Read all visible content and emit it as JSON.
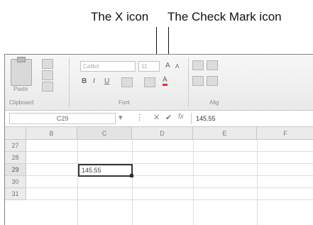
{
  "callouts": {
    "x_icon": "The X icon",
    "check_icon": "The Check Mark icon"
  },
  "ribbon": {
    "paste_label": "Paste",
    "clipboard_label": "Clipboard",
    "font_name": "Calibri",
    "font_size": "11",
    "font_group_label": "Font",
    "alignment_group_label": "Alig"
  },
  "formula_bar": {
    "name_box": "C29",
    "fx_label": "fx",
    "value": "145.55"
  },
  "grid": {
    "columns": [
      "B",
      "C",
      "D",
      "E",
      "F"
    ],
    "rows": [
      "27",
      "28",
      "29",
      "30",
      "31"
    ],
    "active_cell_value": "145.55"
  }
}
